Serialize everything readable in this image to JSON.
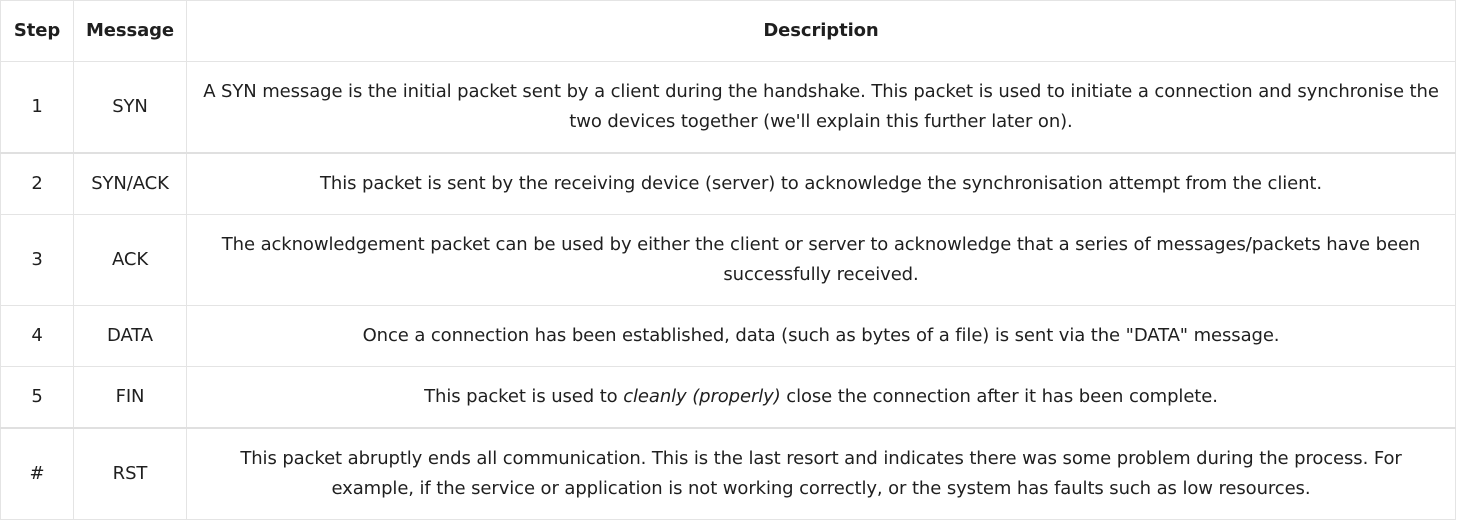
{
  "table": {
    "headers": {
      "step": "Step",
      "message": "Message",
      "description": "Description"
    },
    "rows": [
      {
        "step": "1",
        "message": "SYN",
        "description": "A SYN message is the initial packet sent by a client during the handshake. This packet is used to initiate a connection and synchronise the two devices together (we'll explain this further later on)."
      },
      {
        "step": "2",
        "message": "SYN/ACK",
        "description": "This packet is sent by the receiving device (server) to acknowledge the synchronisation attempt from the client."
      },
      {
        "step": "3",
        "message": "ACK",
        "description": "The acknowledgement packet can be used by either the client or server to acknowledge that a series of messages/packets have been successfully received."
      },
      {
        "step": "4",
        "message": "DATA",
        "description": "Once a connection has been established, data (such as bytes of a file) is sent via the \"DATA\" message."
      },
      {
        "step": "5",
        "message": "FIN",
        "description_before": "This packet is used to ",
        "description_emphasis": "cleanly (properly)",
        "description_after": " close the connection after it has been complete."
      },
      {
        "step": "#",
        "message": "RST",
        "description": "This packet abruptly ends all communication. This is the last resort and indicates there was some problem during the process. For example, if the service or application is not working correctly, or the system has faults such as low resources."
      }
    ]
  }
}
